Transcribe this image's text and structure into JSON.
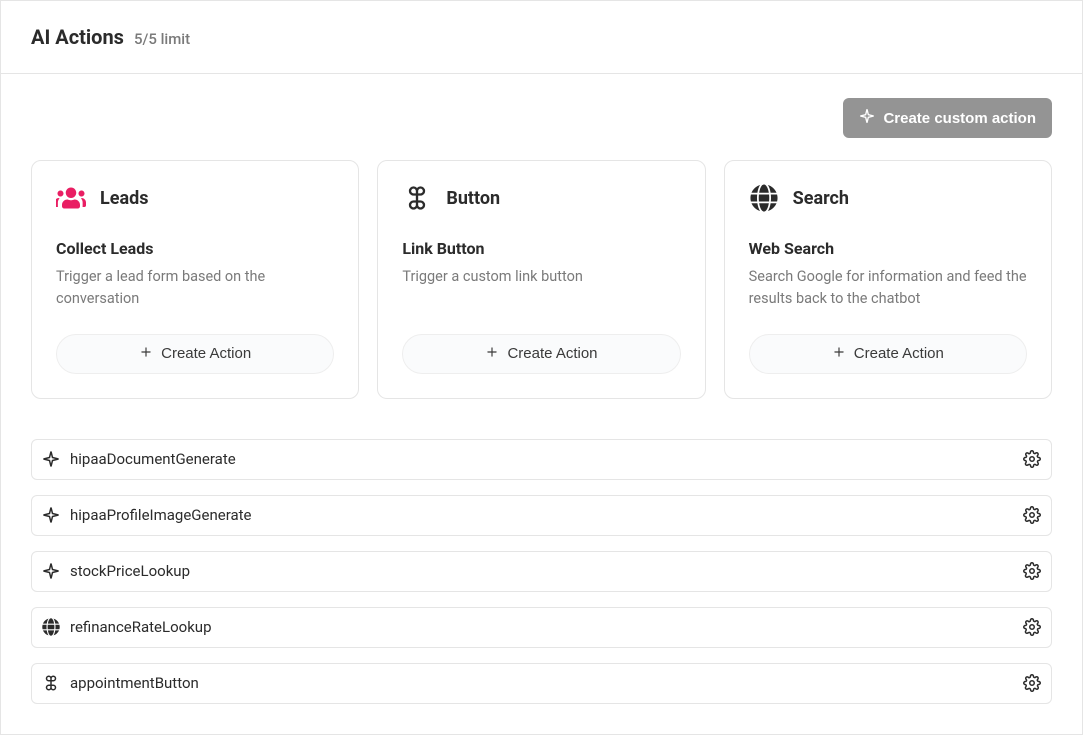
{
  "header": {
    "title": "AI Actions",
    "limit": "5/5 limit"
  },
  "topbar": {
    "create_custom_label": "Create custom action"
  },
  "cards": [
    {
      "icon": "leads-icon",
      "title": "Leads",
      "subtitle": "Collect Leads",
      "description": "Trigger a lead form based on the conversation",
      "button": "Create Action"
    },
    {
      "icon": "cmd-icon",
      "title": "Button",
      "subtitle": "Link Button",
      "description": "Trigger a custom link button",
      "button": "Create Action"
    },
    {
      "icon": "globe-icon",
      "title": "Search",
      "subtitle": "Web Search",
      "description": "Search Google for information and feed the results back to the chatbot",
      "button": "Create Action"
    }
  ],
  "actions": [
    {
      "icon": "sparkle",
      "label": "hipaaDocumentGenerate"
    },
    {
      "icon": "sparkle",
      "label": "hipaaProfileImageGenerate"
    },
    {
      "icon": "sparkle",
      "label": "stockPriceLookup"
    },
    {
      "icon": "globe",
      "label": "refinanceRateLookup"
    },
    {
      "icon": "cmd",
      "label": "appointmentButton"
    }
  ]
}
